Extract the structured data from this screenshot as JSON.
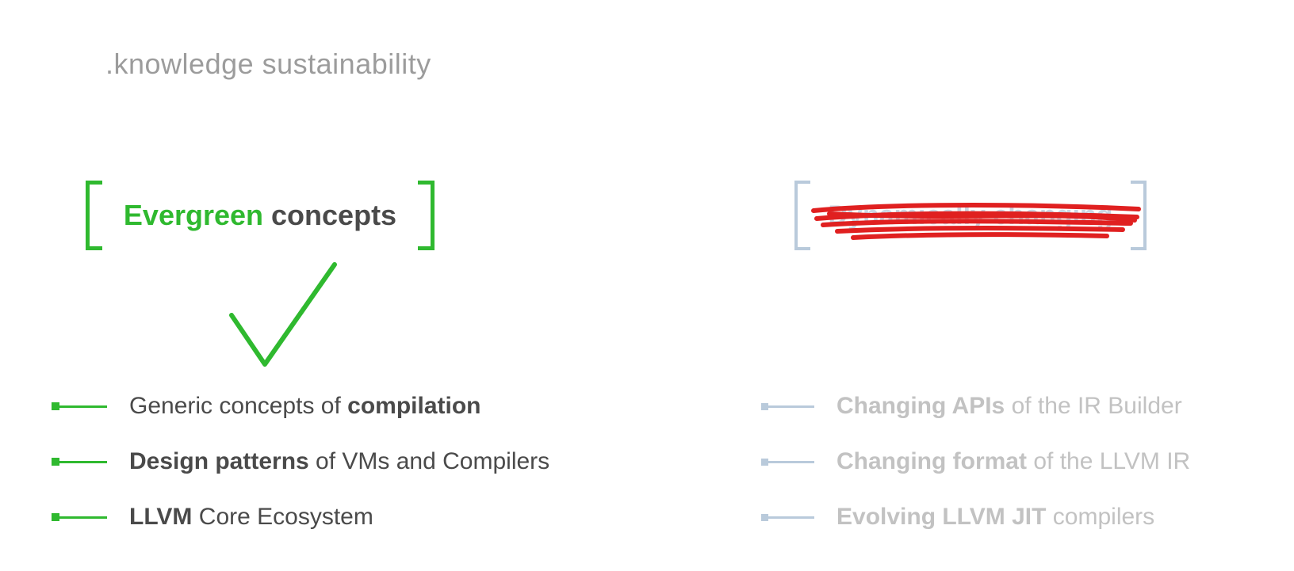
{
  "title": ".knowledge sustainability",
  "left_box": {
    "highlight": "Evergreen",
    "rest": " concepts"
  },
  "right_box": {
    "text": "Dynamically changing"
  },
  "left_bullets": [
    {
      "plain_before": "Generic concepts of ",
      "bold": "compilation",
      "plain_after": ""
    },
    {
      "plain_before": "",
      "bold": "Design patterns",
      "plain_after": " of VMs and Compilers"
    },
    {
      "plain_before": "",
      "bold": "LLVM",
      "plain_after": " Core Ecosystem"
    }
  ],
  "right_bullets": [
    {
      "plain_before": "",
      "bold": "Changing APIs",
      "plain_after": " of the IR Builder"
    },
    {
      "plain_before": "",
      "bold": "Changing format",
      "plain_after": " of the LLVM IR"
    },
    {
      "plain_before": "",
      "bold": "Evolving LLVM JIT",
      "plain_after": " compilers"
    }
  ],
  "colors": {
    "green": "#2fb92f",
    "red": "#e02020",
    "dim_blue": "#b9cadb",
    "dim_text": "#c2c2c2",
    "text": "#4a4a4a",
    "title": "#9c9c9c"
  }
}
